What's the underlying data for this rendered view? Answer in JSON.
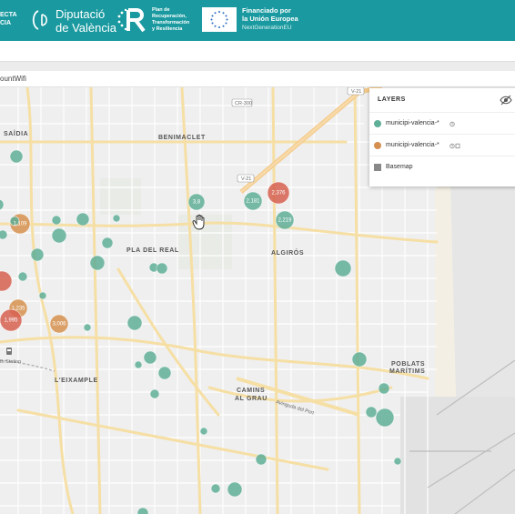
{
  "header": {
    "project_text": "ECTA\nCIA",
    "dv_logo_text": "(DV",
    "dipu_line1": "Diputació",
    "dipu_line2": "de València",
    "plan_line1": "Plan de",
    "plan_line2": "Recuperación,",
    "plan_line3": "Transformación",
    "plan_line4": "y Resiliencia",
    "fin_line1": "Financiado por",
    "fin_line2": "la Unión Europea",
    "next_gen": "NextGenerationEU"
  },
  "titlebar": {
    "text": "ountWifi"
  },
  "map": {
    "districts": [
      "SAÏDIA",
      "BENIMACLET",
      "PLA DEL REAL",
      "ALGIRÓS",
      "L'EIXAMPLE",
      "CAMINS",
      "AL GRAU",
      "POBLATS",
      "MARÍTIMS"
    ],
    "road_labels": [
      "V-21",
      "CR-300",
      "V-21",
      "Avinguda del Port",
      "th Station"
    ],
    "bubbles": [
      {
        "label": "",
        "color": "teal"
      },
      {
        "label": "",
        "color": "teal"
      },
      {
        "label": "1,109",
        "color": "orange"
      },
      {
        "label": "",
        "color": "teal"
      },
      {
        "label": "",
        "color": "teal"
      },
      {
        "label": "",
        "color": "teal"
      },
      {
        "label": "",
        "color": "teal"
      },
      {
        "label": "",
        "color": "teal"
      },
      {
        "label": "",
        "color": "teal"
      },
      {
        "label": "",
        "color": "red"
      },
      {
        "label": "",
        "color": "teal"
      },
      {
        "label": "",
        "color": "teal"
      },
      {
        "label": "1,235",
        "color": "orange"
      },
      {
        "label": "1,995",
        "color": "red"
      },
      {
        "label": "3,006",
        "color": "orange"
      },
      {
        "label": "",
        "color": "teal"
      },
      {
        "label": "",
        "color": "teal"
      },
      {
        "label": "",
        "color": "teal"
      },
      {
        "label": "",
        "color": "teal"
      },
      {
        "label": "",
        "color": "teal"
      },
      {
        "label": "",
        "color": "teal"
      },
      {
        "label": "",
        "color": "teal"
      },
      {
        "label": "",
        "color": "teal"
      },
      {
        "label": "3,8",
        "color": "teal"
      },
      {
        "label": "2,181",
        "color": "teal"
      },
      {
        "label": "2,219",
        "color": "teal"
      },
      {
        "label": "2,376",
        "color": "red"
      },
      {
        "label": "",
        "color": "teal"
      },
      {
        "label": "",
        "color": "teal"
      },
      {
        "label": "",
        "color": "teal"
      },
      {
        "label": "",
        "color": "teal"
      },
      {
        "label": "",
        "color": "teal"
      },
      {
        "label": "",
        "color": "teal"
      },
      {
        "label": "",
        "color": "teal"
      },
      {
        "label": "",
        "color": "teal"
      },
      {
        "label": "",
        "color": "teal"
      },
      {
        "label": "",
        "color": "teal"
      },
      {
        "label": "",
        "color": "teal"
      }
    ],
    "colors": {
      "teal": "#5fae97",
      "orange": "#d5904f",
      "red": "#d6604f",
      "olive": "#9cb07a"
    }
  },
  "layers_panel": {
    "title": "LAYERS",
    "layers": [
      {
        "name": "municipi-valencia-*",
        "type": "dot",
        "color": "#5fae97"
      },
      {
        "name": "municipi-valencia-*",
        "type": "dot",
        "color": "#d5904f"
      },
      {
        "name": "Basemap",
        "type": "square",
        "color": "#888888"
      }
    ]
  }
}
